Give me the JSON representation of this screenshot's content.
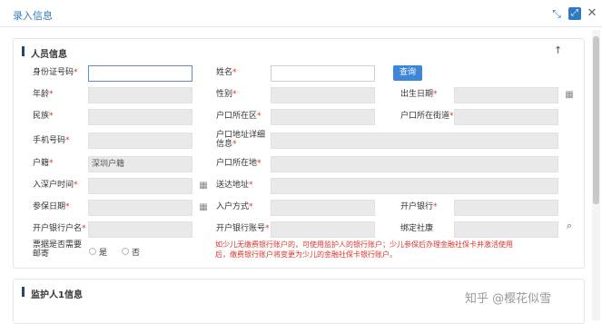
{
  "window": {
    "title": "录入信息"
  },
  "titlebar_icons": {
    "shrink": "shrink-icon",
    "expand": "expand-icon",
    "close": "close-icon"
  },
  "section1": {
    "title": "人员信息",
    "collapse_glyph": "↑",
    "fields": {
      "id_number": {
        "label": "身份证号码",
        "value": ""
      },
      "name": {
        "label": "姓名",
        "value": ""
      },
      "query_button": "查询",
      "age": {
        "label": "年龄",
        "value": ""
      },
      "gender": {
        "label": "性别",
        "value": ""
      },
      "birth_date": {
        "label": "出生日期",
        "value": ""
      },
      "ethnicity": {
        "label": "民族",
        "value": ""
      },
      "hukou_district": {
        "label": "户口所在区",
        "value": ""
      },
      "hukou_street": {
        "label": "户口所在街道",
        "value": ""
      },
      "phone": {
        "label": "手机号码",
        "value": ""
      },
      "hukou_address_line1": "户口地址详细",
      "hukou_address_line2": "信息",
      "hukou_address": {
        "value": ""
      },
      "household": {
        "label": "户籍",
        "value": "深圳户籍"
      },
      "hukou_location": {
        "label": "户口所在地",
        "value": ""
      },
      "enroll_time": {
        "label": "入深户时间",
        "value": ""
      },
      "delivery_address": {
        "label": "送达地址",
        "value": ""
      },
      "insure_date": {
        "label": "参保日期",
        "value": ""
      },
      "enroll_method": {
        "label": "入户方式",
        "value": ""
      },
      "bank": {
        "label": "开户银行",
        "value": ""
      },
      "account_name": {
        "label": "开户银行户名",
        "value": ""
      },
      "account_number": {
        "label": "开户银行账号",
        "value": ""
      },
      "social_card": {
        "label": "绑定社康",
        "value": ""
      },
      "mail_line1": "票据是否需要",
      "mail_line2": "邮寄",
      "radio_yes": "是",
      "radio_no": "否",
      "notice": "如少儿无缴费银行账户的，可使用监护人的银行账户；少儿参保后办理金融社保卡并激活使用后，缴费银行账户将变更为少儿的金融社保卡银行账户。"
    }
  },
  "section2": {
    "title": "监护人1信息"
  },
  "watermark": "知乎 @樱花似雪",
  "required_mark": "*",
  "icons": {
    "calendar": "calendar-icon",
    "search": "search-icon"
  },
  "colors": {
    "accent": "#2f7ac3",
    "button": "#3e87d6",
    "required": "#d9342b",
    "disabled_field": "#e9e9e9"
  }
}
